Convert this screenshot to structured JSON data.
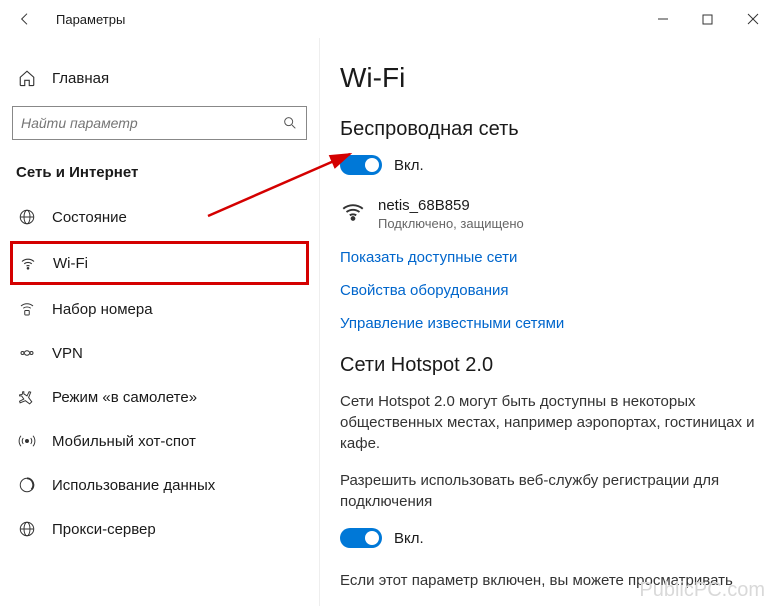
{
  "window": {
    "title": "Параметры",
    "minimize": "—",
    "maximize": "☐",
    "close": "✕"
  },
  "sidebar": {
    "home": "Главная",
    "searchPlaceholder": "Найти параметр",
    "sectionHeader": "Сеть и Интернет",
    "items": [
      {
        "label": "Состояние",
        "icon": "globe"
      },
      {
        "label": "Wi-Fi",
        "icon": "wifi",
        "selected": true
      },
      {
        "label": "Набор номера",
        "icon": "dialup"
      },
      {
        "label": "VPN",
        "icon": "vpn"
      },
      {
        "label": "Режим «в самолете»",
        "icon": "airplane"
      },
      {
        "label": "Мобильный хот-спот",
        "icon": "hotspot"
      },
      {
        "label": "Использование данных",
        "icon": "datausage"
      },
      {
        "label": "Прокси-сервер",
        "icon": "proxy"
      }
    ]
  },
  "content": {
    "pageTitle": "Wi-Fi",
    "wirelessHeader": "Беспроводная сеть",
    "toggleOnLabel": "Вкл.",
    "network": {
      "name": "netis_68B859",
      "status": "Подключено, защищено"
    },
    "links": [
      "Показать доступные сети",
      "Свойства оборудования",
      "Управление известными сетями"
    ],
    "hotspotHeader": "Сети Hotspot 2.0",
    "hotspotBody": "Сети Hotspot 2.0 могут быть доступны в некоторых общественных местах, например аэропортах, гостиницах и кафе.",
    "hotspotPermission": "Разрешить использовать веб-службу регистрации для подключения",
    "hotspotFooter": "Если этот параметр включен, вы можете просматривать"
  },
  "watermark": "PublicPC.com"
}
